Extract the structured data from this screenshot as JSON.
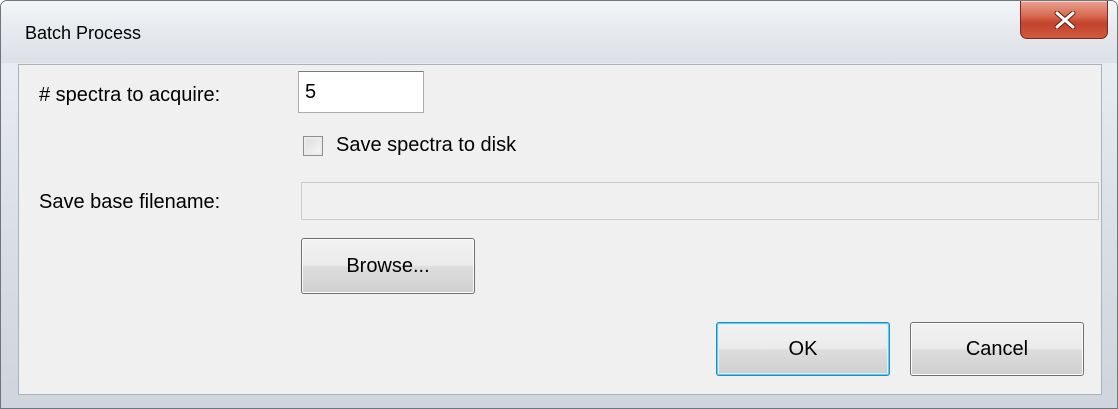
{
  "window": {
    "title": "Batch Process"
  },
  "form": {
    "spectra_label": "# spectra to acquire:",
    "spectra_value": "5",
    "save_checkbox_label": "Save spectra to disk",
    "save_checkbox_checked": false,
    "filename_label": "Save base filename:",
    "filename_value": "",
    "filename_enabled": false
  },
  "buttons": {
    "browse_label": "Browse...",
    "ok_label": "OK",
    "cancel_label": "Cancel"
  },
  "icons": {
    "close": "close-icon"
  },
  "colors": {
    "close_button": "#c7452c",
    "default_button_border": "#3c7fb1",
    "client_background": "#f0f0f0"
  }
}
